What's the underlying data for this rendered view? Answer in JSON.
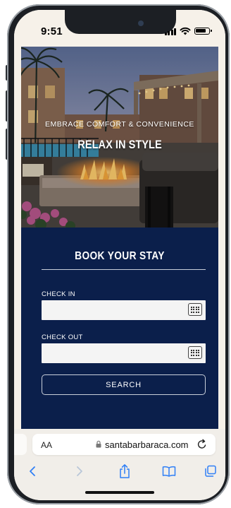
{
  "status_bar": {
    "time": "9:51"
  },
  "hero": {
    "subtitle": "EMBRACE COMFORT & CONVENIENCE",
    "title": "RELAX IN STYLE"
  },
  "booking": {
    "title": "BOOK YOUR STAY",
    "check_in_label": "CHECK IN",
    "check_in_value": "",
    "check_out_label": "CHECK OUT",
    "check_out_value": "",
    "search_label": "SEARCH"
  },
  "browser": {
    "text_size_label": "AA",
    "url": "santabarbaraca.com"
  },
  "colors": {
    "booking_bg": "#0b1f4b",
    "browser_bg": "#f1eee9",
    "text_on_dark": "#ffffff"
  },
  "icons": [
    "signal-icon",
    "wifi-icon",
    "battery-icon",
    "calendar-icon",
    "lock-icon",
    "reload-icon",
    "back-icon",
    "forward-icon",
    "share-icon",
    "bookmarks-icon",
    "tabs-icon"
  ]
}
